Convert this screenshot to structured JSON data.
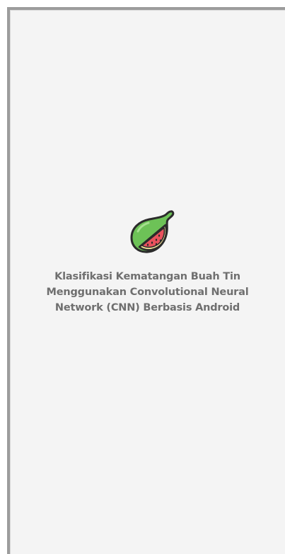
{
  "splash": {
    "logo_icon": "fig-fruit-icon",
    "title_lines": [
      "Klasifikasi Kematangan Buah Tin",
      "Menggunakan Convolutional Neural",
      "Network (CNN) Berbasis Android"
    ]
  },
  "colors": {
    "background": "#f4f4f4",
    "fig_skin": "#6dc257",
    "fig_flesh": "#e9525d",
    "fig_inner_rim": "#f5e39a",
    "outline": "#2b2b2b",
    "title_text": "#6f6f6f"
  }
}
